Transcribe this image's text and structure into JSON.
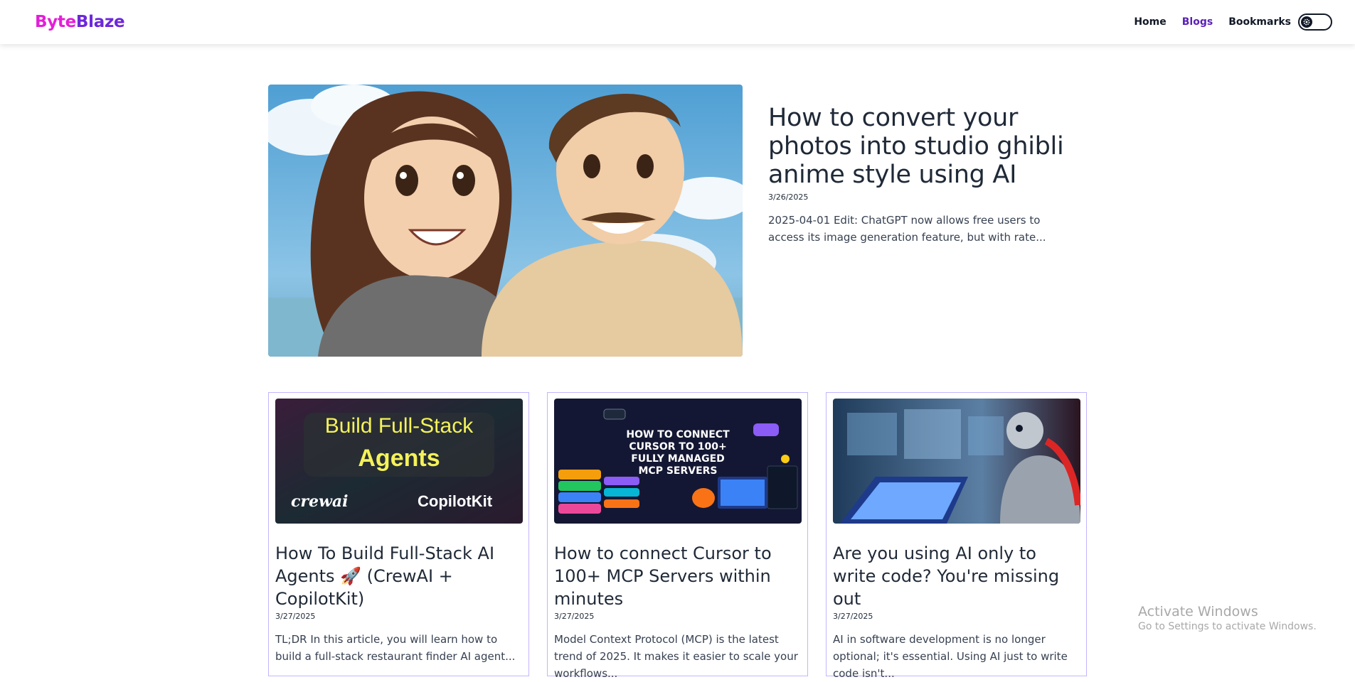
{
  "brand": {
    "part1": "Byte",
    "part2": "Blaze"
  },
  "nav": {
    "links": [
      "Home",
      "Blogs",
      "Bookmarks"
    ],
    "active": "Blogs"
  },
  "theme_toggle": {
    "state": "off",
    "icon": "gear-icon"
  },
  "featured": {
    "title": "How to convert your photos into studio ghibli anime style using AI",
    "date": "3/26/2025",
    "excerpt": "2025-04-01 Edit: ChatGPT now allows free users to access its image generation feature, but with rate..."
  },
  "cards": [
    {
      "title": "How To Build Full-Stack AI Agents 🚀 (CrewAI + CopilotKit)",
      "date": "3/27/2025",
      "excerpt": "TL;DR In this article, you will learn how to build a full-stack restaurant finder AI agent...",
      "thumb": {
        "line1": "Build Full-Stack",
        "line2": "Agents",
        "logo_left": "crewai",
        "logo_right": "CopilotKit"
      }
    },
    {
      "title": "How to connect Cursor to 100+ MCP Servers within minutes",
      "date": "3/27/2025",
      "excerpt": "Model Context Protocol (MCP) is the latest trend of 2025. It makes it easier to scale your workflows...",
      "thumb": {
        "line1": "HOW TO CONNECT",
        "line2": "CURSOR TO 100+",
        "line3": "FULLY MANAGED",
        "line4": "MCP SERVERS"
      }
    },
    {
      "title": "Are you using AI only to write code? You're missing out",
      "date": "3/27/2025",
      "excerpt": "AI in software development is no longer optional; it's essential. Using AI just to write code isn't..."
    }
  ],
  "watermark": {
    "line1": "Activate Windows",
    "line2": "Go to Settings to activate Windows."
  },
  "colors": {
    "brand_pink": "#e41ed8",
    "brand_purple": "#6d28d9",
    "card_border": "#c4b5fd",
    "active_link": "#5b21b6"
  }
}
